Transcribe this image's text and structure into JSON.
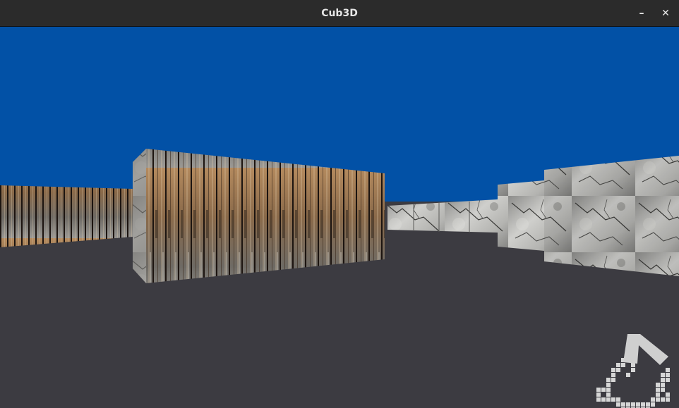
{
  "window": {
    "title": "Cub3D",
    "minimize_glyph": "–",
    "close_glyph": "✕"
  },
  "scene": {
    "ceiling_color": "#0251a6",
    "floor_color": "#3c3b41",
    "wall_textures": [
      "wood-planks",
      "cracked-stone"
    ]
  },
  "minimap": {
    "cell_color": "#d6d6d6",
    "player_arrow_color": "#cfcfcf"
  }
}
